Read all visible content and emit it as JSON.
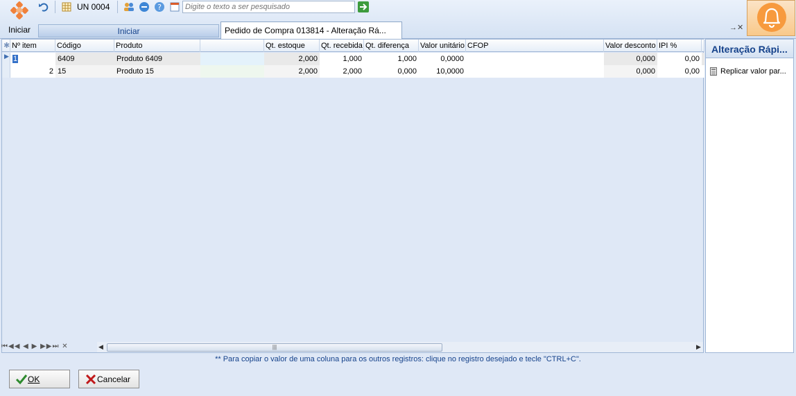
{
  "start": {
    "label": "Iniciar"
  },
  "toolbar": {
    "unit_label": "UN 0004"
  },
  "search": {
    "placeholder": "Digite o texto a ser pesquisado"
  },
  "tabs": {
    "iniciar": "Iniciar",
    "pedido": "Pedido de Compra 013814 - Alteração Rá..."
  },
  "tab_close": "→✕",
  "grid": {
    "columns": [
      "Nº item",
      "Código",
      "Produto",
      "",
      "Qt. estoque",
      "Qt. recebida",
      "Qt. diferença",
      "Valor unitário",
      "CFOP",
      "Valor desconto",
      "IPI %",
      "I"
    ],
    "rows": [
      {
        "item": "1",
        "codigo": "6409",
        "produto": "Produto 6409",
        "qt_estoque": "2,000",
        "qt_recebida": "1,000",
        "qt_diferenca": "1,000",
        "valor_unitario": "0,0000",
        "cfop": "",
        "valor_desconto": "0,000",
        "ipi": "0,00"
      },
      {
        "item": "2",
        "codigo": "15",
        "produto": "Produto 15",
        "qt_estoque": "2,000",
        "qt_recebida": "2,000",
        "qt_diferenca": "0,000",
        "valor_unitario": "10,0000",
        "cfop": "",
        "valor_desconto": "0,000",
        "ipi": "0,00"
      }
    ]
  },
  "nav_strip": "⏮◀◀ ◀ ▶ ▶▶⏭ ✕",
  "side_panel": {
    "title": "Alteração Rápi...",
    "item": "Replicar valor par..."
  },
  "hint": "** Para copiar o valor de uma coluna para os outros registros: clique no registro desejado e tecle \"CTRL+C\".",
  "buttons": {
    "ok": "OK",
    "cancel": "Cancelar"
  },
  "colors": {
    "accent": "#15428b",
    "ok_icon": "#2e8b2e",
    "cancel_icon": "#c0181a",
    "logo": "#f0813b"
  }
}
